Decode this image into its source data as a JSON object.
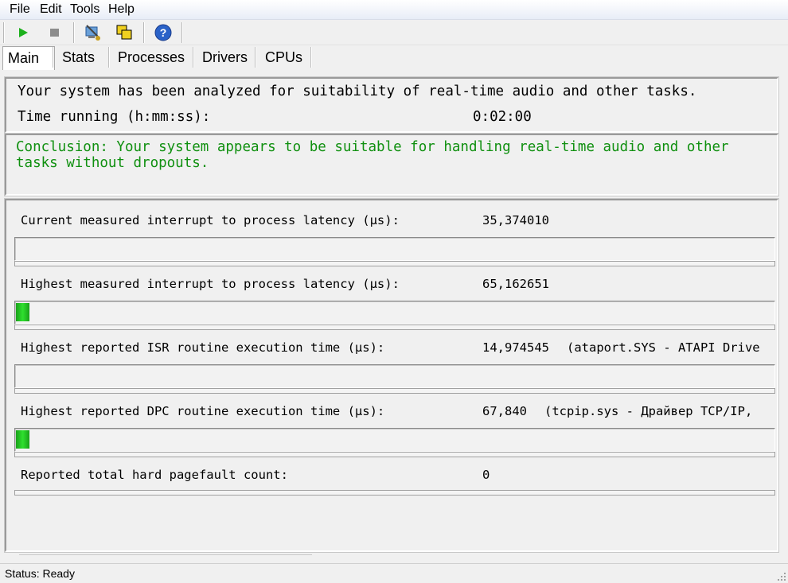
{
  "menu": {
    "file": "File",
    "edit": "Edit",
    "tools": "Tools",
    "help": "Help"
  },
  "toolbar": {
    "icons": [
      "play-icon",
      "stop-icon",
      "drivers-icon",
      "copy-window-icon",
      "help-icon"
    ]
  },
  "tabs": {
    "main": "Main",
    "stats": "Stats",
    "processes": "Processes",
    "drivers": "Drivers",
    "cpus": "CPUs"
  },
  "summary": {
    "analyzed": "Your system has been analyzed for suitability of real-time audio and other tasks.",
    "time_label": "Time running (h:mm:ss):",
    "time_value": "0:02:00"
  },
  "conclusion": "Conclusion: Your system appears to be suitable for handling real-time audio and other tasks without dropouts.",
  "measurements": [
    {
      "label": "Current measured interrupt to process latency (µs):",
      "value": "35,374010",
      "detail": "",
      "level": 0
    },
    {
      "label": "Highest measured interrupt to process latency (µs):",
      "value": "65,162651",
      "detail": "",
      "level": 0.018
    },
    {
      "label": "Highest reported ISR routine execution time (µs):",
      "value": "14,974545",
      "detail": "(ataport.SYS - ATAPI Drive",
      "level": 0
    },
    {
      "label": "Highest reported DPC routine execution time (µs):",
      "value": "67,840",
      "detail": "(tcpip.sys - Драйвер TCP/IP,",
      "level": 0.018
    },
    {
      "label": "Reported total hard pagefault count:",
      "value": "0",
      "detail": ""
    }
  ],
  "status": "Status: Ready",
  "colors": {
    "conclusion": "#109010",
    "bar": "#22cc22"
  }
}
